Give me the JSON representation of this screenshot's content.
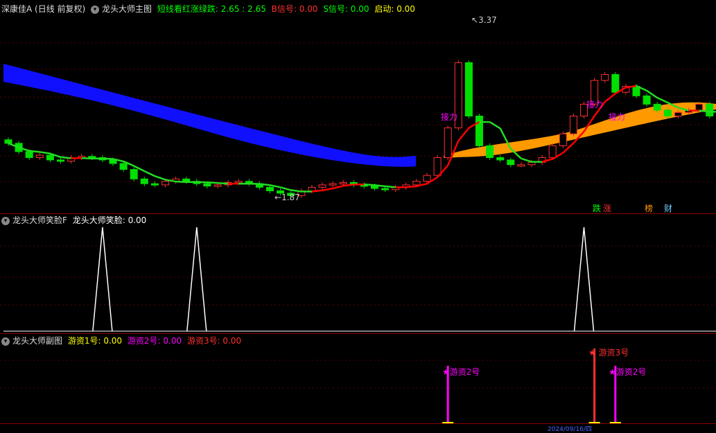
{
  "main_header": {
    "stock": "深康佳A (日线 前复权)",
    "indicator": "龙头大师主图",
    "line1_label": "短线看红涨绿跌: 2.65 : 2.65",
    "b_label": "B信号: 0.00",
    "s_label": "S信号: 0.00",
    "start_label": "启动: 0.00"
  },
  "smile_header": {
    "indicator": "龙头大师笑脸F",
    "value_label": "龙头大师笑脸: 0.00"
  },
  "sub_header": {
    "indicator": "龙头大师副图",
    "yz1_label": "游资1号: 0.00",
    "yz2_label": "游资2号: 0.00",
    "yz3_label": "游资3号: 0.00"
  },
  "annotations": {
    "high": "3.37",
    "low": "1.87",
    "jieli": "接力",
    "diezhang_die": "跌",
    "diezhang_zhang": "涨",
    "bang": "榜",
    "cai": "财",
    "yz2_tag": "★游资2号",
    "yz3_tag": "★ 游资3号",
    "yz2_tag_b": "★游资2号",
    "bottom_date": "2024/09/16/四"
  },
  "colors": {
    "up": "#ff3030",
    "down": "#00e000",
    "ma_up": "#ff0000",
    "ma_down": "#22dd22",
    "band_blue": "#1010ff",
    "band_orange": "#ff9900",
    "magenta": "#ff00ff",
    "yellow": "#ffff00",
    "sep": "#8b0000"
  },
  "chart_data": {
    "type": "candlestick",
    "price_high": 3.37,
    "price_low": 1.87,
    "smile_peaks": [
      {
        "bar": 9
      },
      {
        "bar": 18
      },
      {
        "bar": 55
      }
    ],
    "signals": [
      {
        "bar": 42,
        "name": "游资2号"
      },
      {
        "bar": 56,
        "name": "游资3号"
      },
      {
        "bar": 58,
        "name": "游资2号"
      }
    ]
  }
}
